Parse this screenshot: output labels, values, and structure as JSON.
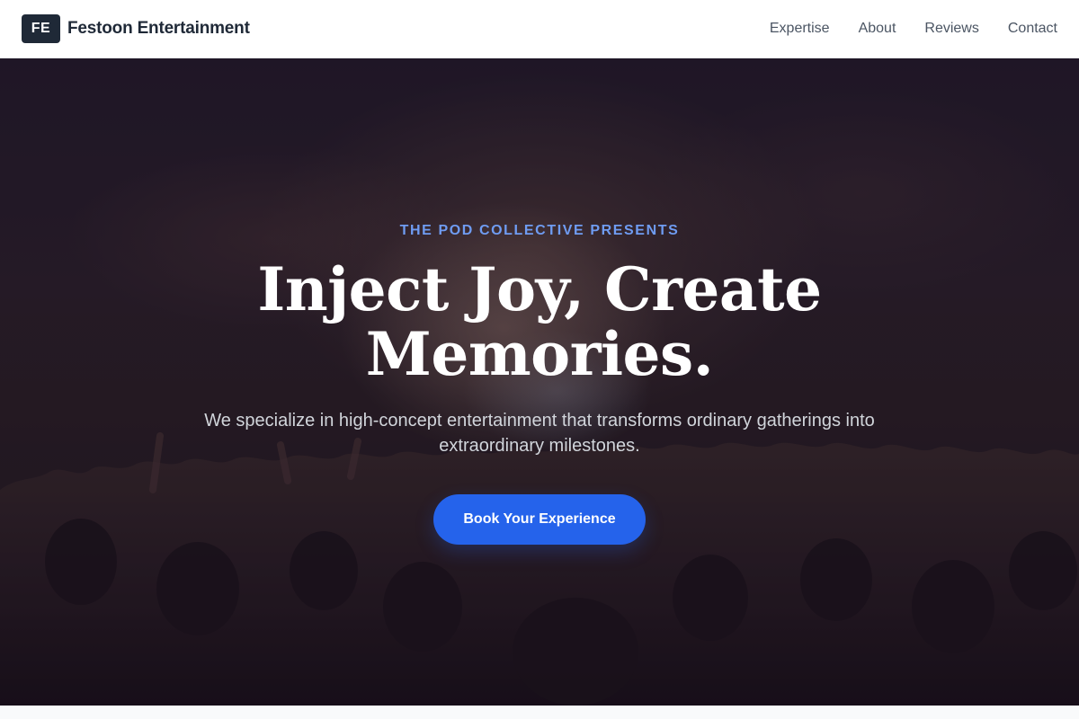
{
  "header": {
    "logo_mark": "FE",
    "brand_name": "Festoon Entertainment",
    "nav": [
      {
        "label": "Expertise"
      },
      {
        "label": "About"
      },
      {
        "label": "Reviews"
      },
      {
        "label": "Contact"
      }
    ]
  },
  "hero": {
    "eyebrow": "THE POD COLLECTIVE PRESENTS",
    "title": "Inject Joy, Create Memories.",
    "subtitle": "We specialize in high-concept entertainment that transforms ordinary gatherings into extraordinary milestones.",
    "cta_label": "Book Your Experience"
  },
  "colors": {
    "accent": "#2563eb",
    "eyebrow": "#6f9cf2",
    "logo_bg": "#1f2937",
    "brand_text": "#1f2937",
    "nav_text": "#4b5563"
  }
}
